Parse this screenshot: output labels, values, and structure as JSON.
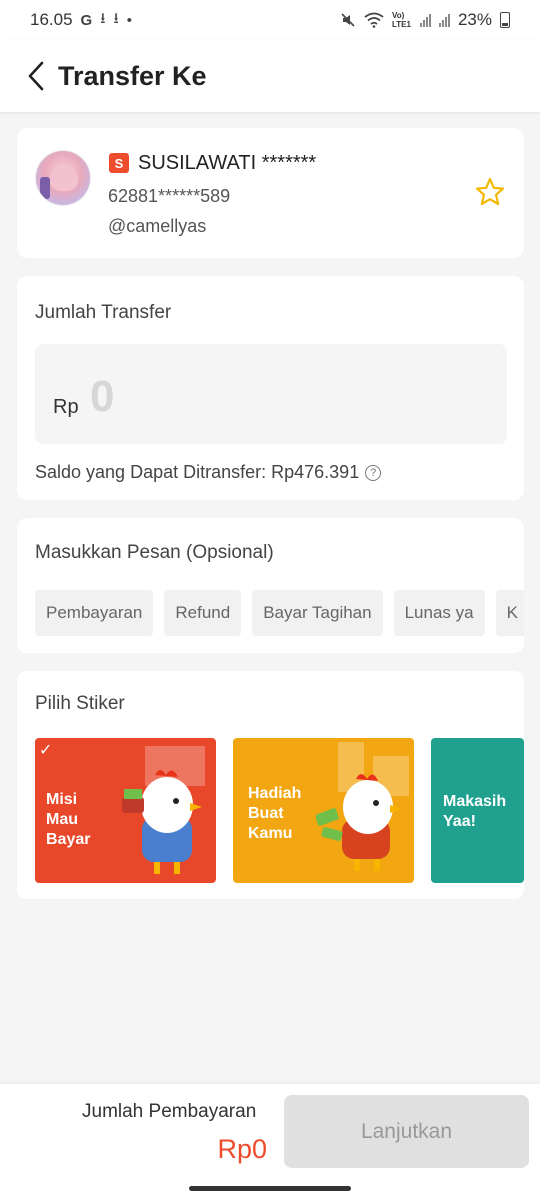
{
  "status_bar": {
    "time": "16.05",
    "notif_icons": [
      "G",
      "⭳",
      "⭳",
      "•"
    ],
    "network": "Vo) LTE1",
    "battery": "23%"
  },
  "header": {
    "title": "Transfer Ke"
  },
  "recipient": {
    "shop_badge": "S",
    "name": "SUSILAWATI *******",
    "phone": "62881******589",
    "username": "@camellyas"
  },
  "amount": {
    "label": "Jumlah Transfer",
    "currency": "Rp",
    "value": "0",
    "balance_text": "Saldo yang Dapat Ditransfer: Rp476.391"
  },
  "message": {
    "label": "Masukkan Pesan (Opsional)",
    "chips": [
      "Pembayaran",
      "Refund",
      "Bayar Tagihan",
      "Lunas ya",
      "K"
    ]
  },
  "stickers": {
    "label": "Pilih Stiker",
    "items": [
      {
        "text": "Misi\nMau Bayar",
        "color": "#e8472a",
        "selected": true
      },
      {
        "text": "Hadiah\nBuat\nKamu",
        "color": "#f2a712",
        "selected": false
      },
      {
        "text": "Makasih\nYaa!",
        "color": "#20a190",
        "selected": false
      }
    ]
  },
  "bottom": {
    "pay_label": "Jumlah Pembayaran",
    "pay_amount": "Rp0",
    "next_label": "Lanjutkan"
  },
  "colors": {
    "accent": "#ee4d2d",
    "star": "#f5b800",
    "disabled_btn": "#e0e0e0"
  }
}
